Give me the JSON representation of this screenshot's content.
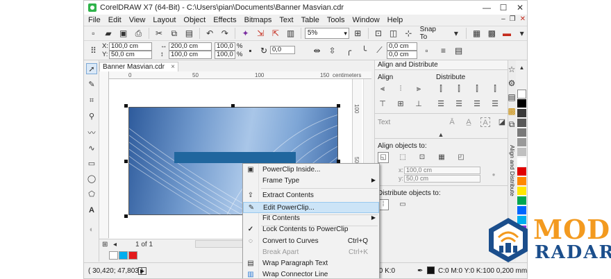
{
  "window": {
    "title": "CorelDRAW X7 (64-Bit) - C:\\Users\\pian\\Documents\\Banner Masvian.cdr",
    "minimize": "—",
    "maximize": "☐",
    "close": "✕"
  },
  "menu": [
    "File",
    "Edit",
    "View",
    "Layout",
    "Object",
    "Effects",
    "Bitmaps",
    "Text",
    "Table",
    "Tools",
    "Window",
    "Help"
  ],
  "toolbar": {
    "zoom_value": "5%",
    "snap_label": "Snap To"
  },
  "properties": {
    "x": "100,0 cm",
    "y": "50,0 cm",
    "width": "200,0 cm",
    "height": "100,0 cm",
    "scale_w": "100,0",
    "scale_h": "100,0",
    "percent_w": "%",
    "percent_h": "%",
    "rotation": "0,0",
    "corner_a": "0,0 cm",
    "corner_b": "0,0 cm",
    "x_label": "X:",
    "y_label": "Y:"
  },
  "document_tab": "Banner Masvian.cdr",
  "ruler": {
    "marks": [
      "0",
      "50",
      "100",
      "150"
    ],
    "unit": "centimeters",
    "vmarks": [
      "100",
      "50"
    ]
  },
  "page_nav": {
    "page_text": "1 of 1"
  },
  "docker": {
    "title": "Align and Distribute",
    "align_label": "Align",
    "distribute_label": "Distribute",
    "text_label": "Text",
    "align_objects_to": "Align objects to:",
    "x_label": "x:",
    "y_label": "y:",
    "x_value": "100,0 cm",
    "y_value": "50,0 cm",
    "distribute_objects_to": "Distribute objects to:",
    "side_tab_label": "Align and Distribute"
  },
  "context_menu": {
    "items": [
      {
        "label": "PowerClip Inside...",
        "shortcut": "",
        "submenu": false,
        "icon": "powerclip-icon",
        "state": "normal"
      },
      {
        "label": "Frame Type",
        "shortcut": "",
        "submenu": true,
        "icon": "",
        "state": "normal"
      },
      {
        "label": "Extract Contents",
        "shortcut": "",
        "submenu": false,
        "icon": "extract-icon",
        "state": "normal"
      },
      {
        "label": "Edit PowerClip...",
        "shortcut": "",
        "submenu": false,
        "icon": "edit-powerclip-icon",
        "state": "highlighted"
      },
      {
        "label": "Fit Contents",
        "shortcut": "",
        "submenu": true,
        "icon": "",
        "state": "normal"
      },
      {
        "label": "Lock Contents to PowerClip",
        "shortcut": "",
        "submenu": false,
        "icon": "check-icon",
        "state": "checked"
      },
      {
        "label": "Convert to Curves",
        "shortcut": "Ctrl+Q",
        "submenu": false,
        "icon": "curves-icon",
        "state": "normal"
      },
      {
        "label": "Break Apart",
        "shortcut": "Ctrl+K",
        "submenu": false,
        "icon": "",
        "state": "disabled"
      },
      {
        "label": "Wrap Paragraph Text",
        "shortcut": "",
        "submenu": false,
        "icon": "wrap-icon",
        "state": "normal"
      },
      {
        "label": "Wrap Connector Line",
        "shortcut": "",
        "submenu": false,
        "icon": "connector-icon",
        "state": "normal"
      }
    ]
  },
  "status": {
    "coords": "( 30,420; 47,803 )",
    "fill_text": "C:0 M:100 Y:100 K:0",
    "outline_text": "C:0 M:0 Y:0 K:100  0,200 mm"
  },
  "colors": {
    "fill_swatch": "#e31a1c",
    "outline_swatch": "#111111",
    "banner_blue": "#20669e",
    "palette": [
      "#ffffff",
      "#000000",
      "#3a3a3a",
      "#5a5a5a",
      "#7a7a7a",
      "#9a9a9a",
      "#c0c0c0",
      "#e00000",
      "#ff8800",
      "#ffe600",
      "#00a651",
      "#0066ff",
      "#00aeef",
      "#8a2be2",
      "#ff00ff"
    ]
  },
  "watermark": {
    "line1": "MOD",
    "line2": "RADAR"
  }
}
